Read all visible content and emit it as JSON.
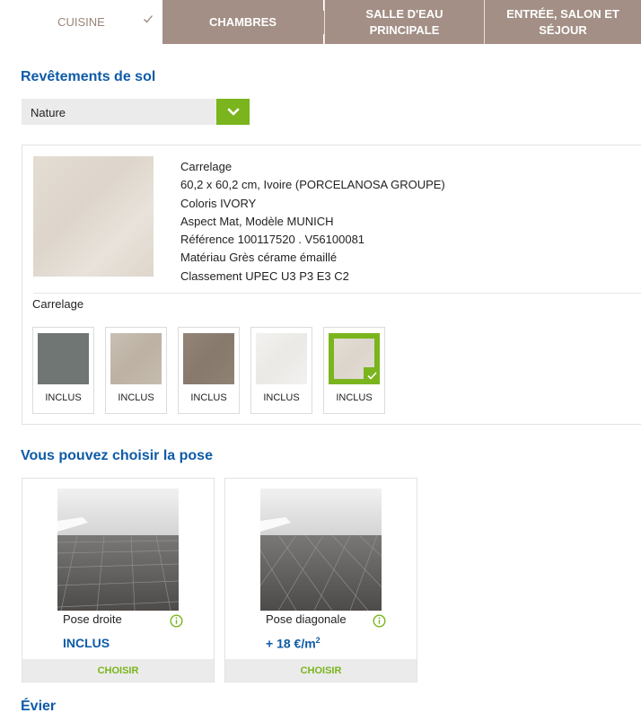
{
  "tabs": [
    {
      "label": "CUISINE",
      "active": true
    },
    {
      "label": "CHAMBRES",
      "active": false
    },
    {
      "label": "SALLE D'EAU PRINCIPALE",
      "active": false
    },
    {
      "label": "ENTRÉE, SALON ET SÉJOUR",
      "active": false
    }
  ],
  "flooring": {
    "title": "Revêtements de sol",
    "select_value": "Nature"
  },
  "product": {
    "lines": [
      "Carrelage",
      "60,2 x 60,2 cm, Ivoire (PORCELANOSA GROUPE)",
      "Coloris IVORY",
      "Aspect Mat, Modèle MUNICH",
      "Référence 100117520 . V56100081",
      "Matériau Grès cérame émaillé",
      "Classement UPEC U3 P3 E3 C2"
    ],
    "sub_label": "Carrelage",
    "tiles": [
      {
        "label": "INCLUS",
        "color": "#6f7674",
        "selected": false
      },
      {
        "label": "INCLUS",
        "color": "#c2b8aa",
        "selected": false
      },
      {
        "label": "INCLUS",
        "color": "#8d7f72",
        "selected": false
      },
      {
        "label": "INCLUS",
        "color": "#f0efed",
        "selected": false
      },
      {
        "label": "INCLUS",
        "color": "#e3ddd5",
        "selected": true
      }
    ]
  },
  "pose": {
    "title": "Vous pouvez choisir la pose",
    "options": [
      {
        "name": "Pose droite",
        "price": "INCLUS",
        "price_sup": "",
        "button": "CHOISIR"
      },
      {
        "name": "Pose diagonale",
        "price": "+ 18 €/m",
        "price_sup": "2",
        "button": "CHOISIR"
      }
    ]
  },
  "sink": {
    "title": "Évier"
  },
  "colors": {
    "accent_green": "#7ab51d",
    "title_blue": "#0e5ba8",
    "tab_brown": "#a38f85"
  }
}
